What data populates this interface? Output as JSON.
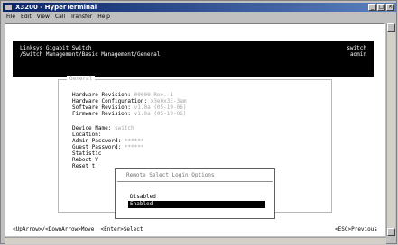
{
  "window": {
    "title": "X3200 - HyperTerminal"
  },
  "menu": [
    "File",
    "Edit",
    "View",
    "Call",
    "Transfer",
    "Help"
  ],
  "terminal": {
    "header_left_1": "Linksys Gigabit Switch",
    "header_left_2": "/Switch Management/Basic Management/General",
    "header_right_1": "switch",
    "header_right_2": "admin",
    "box_title": "General",
    "fields": [
      {
        "label": "Hardware Revision: ",
        "value": "00000 Rev. 1"
      },
      {
        "label": "Hardware Configuration: ",
        "value": "x3e0x3E-3am"
      },
      {
        "label": "Software Revision: ",
        "value": "v1.0a (05-19-06)"
      },
      {
        "label": "Firmware Revision: ",
        "value": "v1.0a (05-19-06)"
      },
      {
        "label": "Device Name: ",
        "value": "switch"
      },
      {
        "label": "Location: ",
        "value": ""
      },
      {
        "label": "Admin Password: ",
        "value": "******"
      },
      {
        "label": "Guest Password: ",
        "value": "******"
      },
      {
        "label": "Statistic",
        "value": ""
      },
      {
        "label": "Reboot V",
        "value": ""
      },
      {
        "label": "Reset t",
        "value": ""
      }
    ],
    "popup": {
      "title": "Remote Select Login Options",
      "options": [
        "Disabled",
        "Enabled"
      ],
      "selected": "Enabled"
    },
    "footer_left": "<UpArrow>/<DownArrow>Move  <Enter>Select",
    "footer_right": "<ESC>Previous"
  }
}
